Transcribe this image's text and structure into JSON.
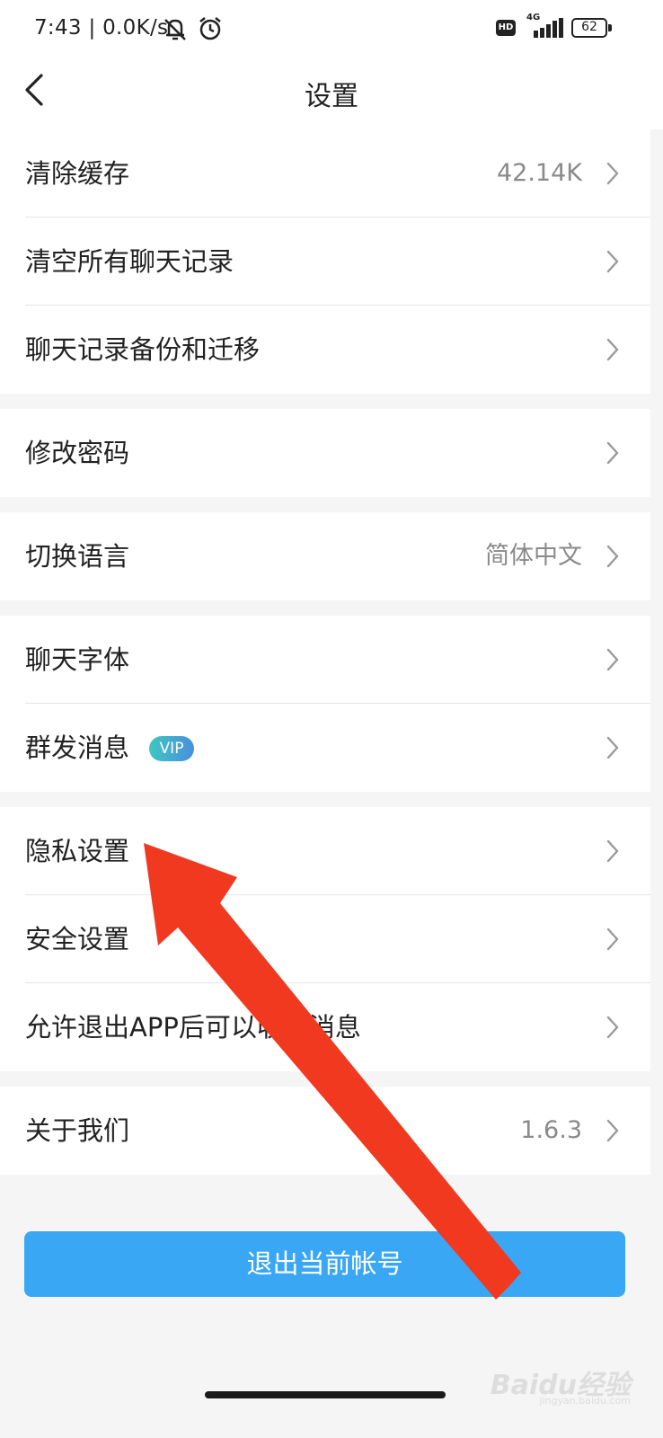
{
  "status_bar": {
    "time": "7:43 | 0.0K/s",
    "network": "4G",
    "hd": "HD",
    "battery": "62"
  },
  "header": {
    "title": "设置"
  },
  "settings": {
    "clear_cache": {
      "label": "清除缓存",
      "value": "42.14K"
    },
    "clear_chat_history": {
      "label": "清空所有聊天记录"
    },
    "chat_backup": {
      "label": "聊天记录备份和迁移"
    },
    "change_password": {
      "label": "修改密码"
    },
    "switch_language": {
      "label": "切换语言",
      "value": "简体中文"
    },
    "chat_font": {
      "label": "聊天字体"
    },
    "group_message": {
      "label": "群发消息",
      "badge": "VIP"
    },
    "privacy_settings": {
      "label": "隐私设置"
    },
    "security_settings": {
      "label": "安全设置"
    },
    "background_messages": {
      "label": "允许退出APP后可以收到消息"
    },
    "about_us": {
      "label": "关于我们",
      "value": "1.6.3"
    }
  },
  "logout_button": {
    "label": "退出当前帐号"
  },
  "watermark": {
    "text": "Baidu经验",
    "sub": "jingyan.baidu.com"
  },
  "colors": {
    "accent": "#3aa7f4",
    "annotation_arrow": "#f0391f",
    "vip_gradient_start": "#3fc6c0",
    "vip_gradient_end": "#4a8fe0"
  }
}
